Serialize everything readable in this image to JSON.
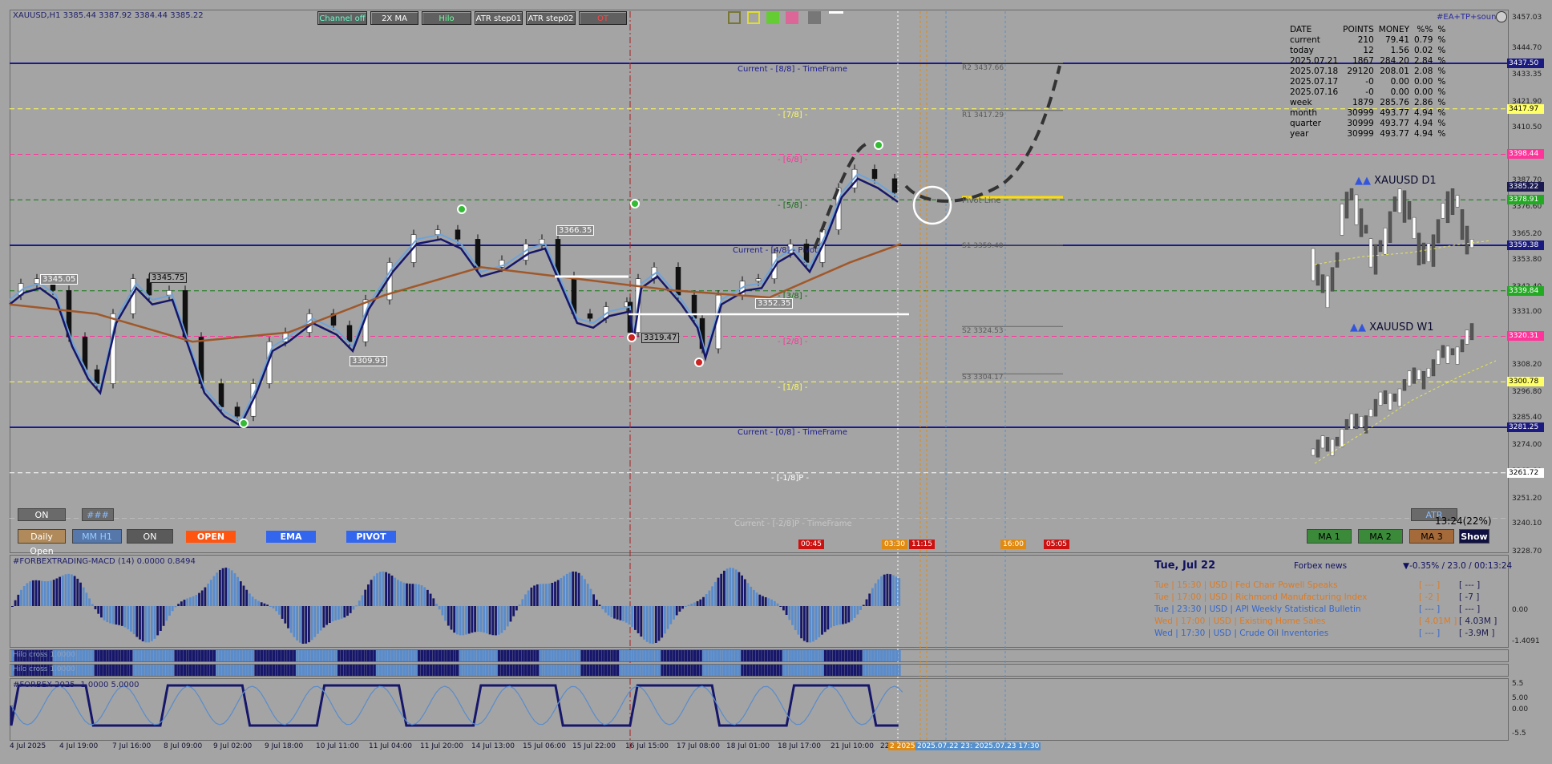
{
  "chart": {
    "symbol_header": "XAUUSD,H1  3385.44 3387.92 3384.44 3385.22",
    "ea_label": "#EA+TP+sound",
    "toolbar_buttons": [
      "Channel off",
      "2X MA",
      "Hilo",
      "ATR step01",
      "ATR step02",
      "OT"
    ]
  },
  "levels": {
    "eight": "Current - [8/8] - TimeFrame",
    "seven": "- [7/8] -",
    "six": "- [6/8] -",
    "five": "- [5/8] -",
    "four": "Current - [4/8] - Pivot",
    "three": "- [3/8] -",
    "two": "- [2/8] -",
    "one": "- [1/8] -",
    "zero": "Current - [0/8] - TimeFrame",
    "minus1": "- [-1/8]P -",
    "minus2": "Current - [-2/8]P - TimeFrame",
    "r2": "R2 3437.66",
    "r1": "R1 3417.29",
    "pivot": "Pivot Line",
    "s1": "S1 3359.40",
    "s2": "S2 3324.53",
    "s3": "S3 3304.17"
  },
  "swing_labels": {
    "a": "3345.05",
    "b": "3345.75",
    "c": "3309.93",
    "d": "3366.35",
    "e": "3319.47",
    "f": "3352.35"
  },
  "price_axis": [
    "3457.03",
    "3444.70",
    "3433.35",
    "3421.90",
    "3410.50",
    "3398.44",
    "3387.70",
    "3376.60",
    "3365.20",
    "3353.80",
    "3342.40",
    "3331.00",
    "3319.60",
    "3308.20",
    "3296.80",
    "3285.40",
    "3274.00",
    "3262.60",
    "3251.20",
    "3240.10",
    "3228.70"
  ],
  "price_boxes": [
    {
      "v": "3437.50",
      "bg": "#1a1a80",
      "fg": "#ffffff"
    },
    {
      "v": "3417.97",
      "bg": "#ffff66",
      "fg": "#000000"
    },
    {
      "v": "3398.44",
      "bg": "#ff3399",
      "fg": "#ffffff"
    },
    {
      "v": "3385.22",
      "bg": "#1a1a50",
      "fg": "#ffffff"
    },
    {
      "v": "3378.91",
      "bg": "#22aa22",
      "fg": "#ffffff"
    },
    {
      "v": "3359.38",
      "bg": "#1a1a80",
      "fg": "#ffffff"
    },
    {
      "v": "3339.84",
      "bg": "#22aa22",
      "fg": "#ffffff"
    },
    {
      "v": "3320.31",
      "bg": "#ff3399",
      "fg": "#ffffff"
    },
    {
      "v": "3300.78",
      "bg": "#ffff66",
      "fg": "#000000"
    },
    {
      "v": "3281.25",
      "bg": "#1a1a80",
      "fg": "#ffffff"
    },
    {
      "v": "3261.72",
      "bg": "#ffffff",
      "fg": "#000000"
    }
  ],
  "stats": {
    "headers": [
      "DATE",
      "POINTS",
      "MONEY",
      "%%",
      "%"
    ],
    "rows": [
      [
        "current",
        "210",
        "79.41",
        "0.79",
        "%"
      ],
      [
        "today",
        "12",
        "1.56",
        "0.02",
        "%"
      ],
      [
        "2025.07.21",
        "1867",
        "284.20",
        "2.84",
        "%"
      ],
      [
        "2025.07.18",
        "29120",
        "208.01",
        "2.08",
        "%"
      ],
      [
        "2025.07.17",
        "-0",
        "0.00",
        "0.00",
        "%"
      ],
      [
        "2025.07.16",
        "-0",
        "0.00",
        "0.00",
        "%"
      ],
      [
        "week",
        "1879",
        "285.76",
        "2.86",
        "%"
      ],
      [
        "month",
        "30999",
        "493.77",
        "4.94",
        "%"
      ],
      [
        "quarter",
        "30999",
        "493.77",
        "4.94",
        "%"
      ],
      [
        "year",
        "30999",
        "493.77",
        "4.94",
        "%"
      ]
    ]
  },
  "tf_labels": {
    "d1": "XAUUSD D1",
    "w1": "XAUUSD W1"
  },
  "bottom_buttons": {
    "on1": "ON",
    "hash": "###",
    "daily_open": "Daily Open",
    "mm_h1": "MM H1",
    "on2": "ON",
    "open": "OPEN",
    "ema": "EMA",
    "pivot": "PIVOT",
    "ma1": "MA 1",
    "ma2": "MA 2",
    "ma3": "MA 3",
    "show": "Show",
    "atr": "ATR",
    "timer": "13:24(22%)"
  },
  "session_tags": [
    "00:45",
    "03:30",
    "11:15",
    "16:00",
    "05:05"
  ],
  "indicators": {
    "macd_title": "#FORBEXTRADING-MACD (14) 0.0000 0.8494",
    "macd_axis": [
      "0.00",
      "-1.4091"
    ],
    "hl1": "Hilo cross 1.0000",
    "hl2": "Hilo cross 1.0000",
    "forbex_title": "#FORBEX-2025 -1.0000 5.0000",
    "forbex_axis": [
      "5.5",
      "5.00",
      "0.00",
      "-5.5"
    ]
  },
  "news": {
    "date": "Tue, Jul 22",
    "source": "Forbex news",
    "change": "▼-0.35% / 23.0 / 00:13:24",
    "items": [
      {
        "text": "Tue  |  15:30  |  USD  |  Fed Chair Powell Speaks",
        "a": "[ --- ]",
        "b": "[ --- ]",
        "color": "#e07a20"
      },
      {
        "text": "Tue  |  17:00  |  USD  |  Richmond Manufacturing Index",
        "a": "[ -2 ]",
        "b": "[ -7 ]",
        "color": "#e07a20"
      },
      {
        "text": "Tue  |  23:30  |  USD  |  API Weekly Statistical Bulletin",
        "a": "[ --- ]",
        "b": "[ --- ]",
        "color": "#3366cc"
      },
      {
        "text": "Wed  |  17:00  |  USD  |  Existing Home Sales",
        "a": "[ 4.01M ]",
        "b": "[ 4.03M ]",
        "color": "#e07a20"
      },
      {
        "text": "Wed  |  17:30  |  USD  |  Crude Oil Inventories",
        "a": "[ --- ]",
        "b": "[ -3.9M ]",
        "color": "#3366cc"
      }
    ]
  },
  "dates": [
    "4 Jul 2025",
    "4 Jul 19:00",
    "7 Jul 16:00",
    "8 Jul 09:00",
    "9 Jul 02:00",
    "9 Jul 18:00",
    "10 Jul 11:00",
    "11 Jul 04:00",
    "11 Jul 20:00",
    "14 Jul 13:00",
    "15 Jul 06:00",
    "15 Jul 22:00",
    "16 Jul 15:00",
    "17 Jul 08:00",
    "18 Jul 01:00",
    "18 Jul 17:00",
    "21 Jul 10:00",
    "22"
  ],
  "date_tags": [
    "2 2025",
    "2025.07.22 23:3",
    "2025.07.23 17:30"
  ]
}
